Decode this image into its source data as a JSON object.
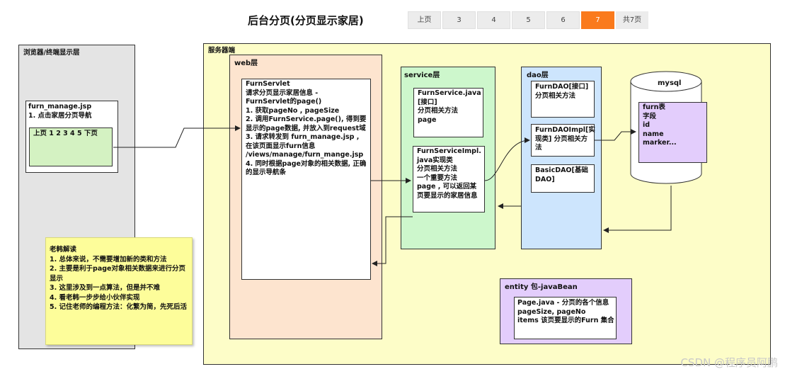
{
  "title": "后台分页(分页显示家居)",
  "pagination": {
    "prev": "上页",
    "pages": [
      "3",
      "4",
      "5",
      "6",
      "7"
    ],
    "current": "7",
    "total": "共7页"
  },
  "browser_layer": {
    "label": "浏览器/终端显示层",
    "jsp": "furn_manage.jsp\n1. 点击家居分页导航",
    "nav": "上页  1 2 3 4 5 下页"
  },
  "note": {
    "text": "老韩解读\n1. 总体来说，不需要增加新的类和方法\n2. 主要是利于page对象相关数据来进行分页显示\n3. 这里涉及到一点算法，但是并不难\n4. 看老韩一步步给小伙伴实现\n5. 记住老师的编程方法：化繁为简，先死后活"
  },
  "server": {
    "label": "服务器端",
    "web_label": "web层",
    "servlet": "FurnServlet\n请求分页显示家居信息 -\nFurnServlet的page()\n1. 获取pageNo , pageSize\n2. 调用FurnService.page(), 得到要显示的page数据, 并放入到request域\n3. 请求转发到 furn_manage.jsp , 在该页面显示furn信息 /views/manage/furn_mange.jsp\n4. 同时根据page对象的相关数据, 正确的显示导航条",
    "service_label": "service层",
    "service_iface": "FurnService.java\n[接口]\n分页相关方法\npage",
    "service_impl": "FurnServiceImpl.\njava实现类\n分页相关方法\n一个重要方法\npage , 可以返回某页要显示的家居信息",
    "dao_label": "dao层",
    "dao_iface": "FurnDAO[接口] 分页相关方法",
    "dao_impl": "FurnDAOImpl[实现类] 分页相关方法",
    "base_dao": "BasicDAO[基础DAO]",
    "db_label": "mysql",
    "table": "furn表\n字段\nid\nname\nmarker...",
    "entity_label": "entity 包-javaBean",
    "entity": "Page.java - 分页的各个信息 pageSize, pageNo\nitems 该页要显示的Furn 集合"
  },
  "watermark": "CSDN @程序员阿鹏"
}
